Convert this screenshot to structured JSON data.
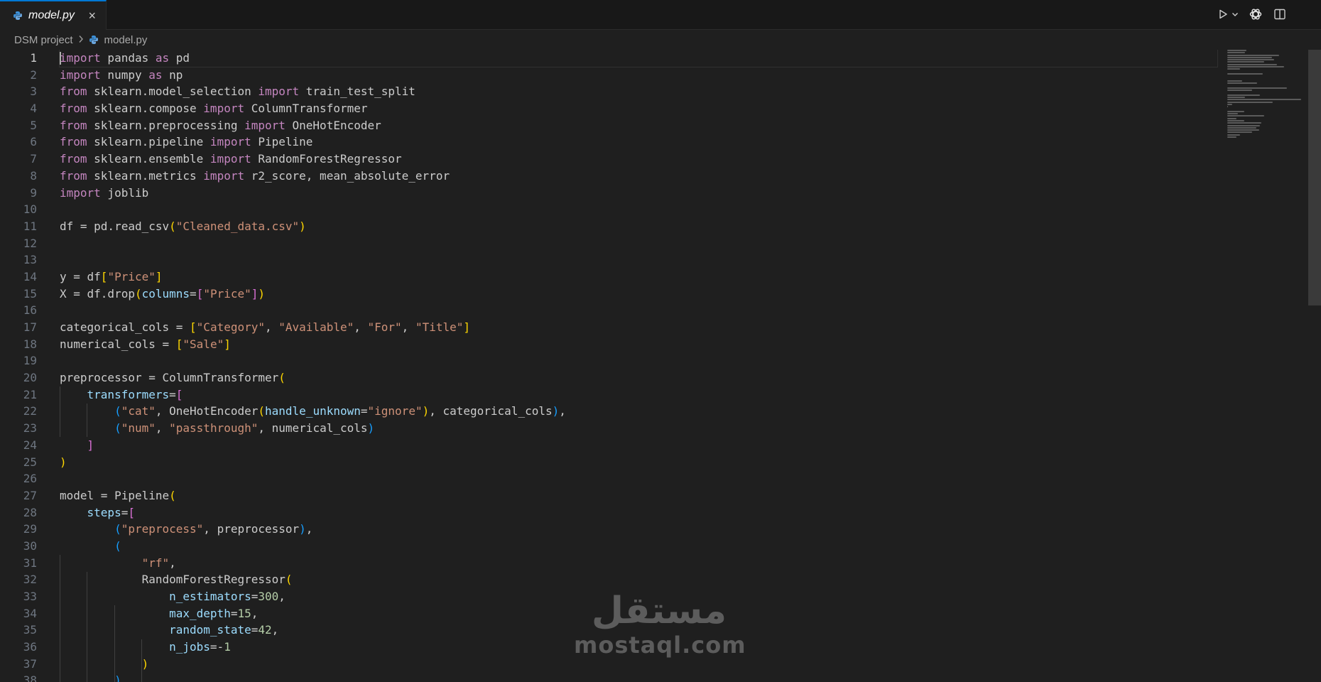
{
  "tab": {
    "filename": "model.py",
    "close_icon": "×"
  },
  "breadcrumb": {
    "project": "DSM project",
    "file": "model.py"
  },
  "editor": {
    "active_line": 1,
    "line_numbers": [
      "1",
      "2",
      "3",
      "4",
      "5",
      "6",
      "7",
      "8",
      "9",
      "10",
      "11",
      "12",
      "13",
      "14",
      "15",
      "16",
      "17",
      "18",
      "19",
      "20",
      "21",
      "22",
      "23",
      "24",
      "25",
      "26",
      "27",
      "28",
      "29",
      "30",
      "31",
      "32",
      "33",
      "34",
      "35",
      "36",
      "37",
      "38"
    ],
    "lines": [
      [
        [
          "kw",
          "import"
        ],
        [
          "t",
          " pandas "
        ],
        [
          "kw",
          "as"
        ],
        [
          "t",
          " pd"
        ]
      ],
      [
        [
          "kw",
          "import"
        ],
        [
          "t",
          " numpy "
        ],
        [
          "kw",
          "as"
        ],
        [
          "t",
          " np"
        ]
      ],
      [
        [
          "kw",
          "from"
        ],
        [
          "t",
          " sklearn.model_selection "
        ],
        [
          "kw",
          "import"
        ],
        [
          "t",
          " train_test_split"
        ]
      ],
      [
        [
          "kw",
          "from"
        ],
        [
          "t",
          " sklearn.compose "
        ],
        [
          "kw",
          "import"
        ],
        [
          "t",
          " ColumnTransformer"
        ]
      ],
      [
        [
          "kw",
          "from"
        ],
        [
          "t",
          " sklearn.preprocessing "
        ],
        [
          "kw",
          "import"
        ],
        [
          "t",
          " OneHotEncoder"
        ]
      ],
      [
        [
          "kw",
          "from"
        ],
        [
          "t",
          " sklearn.pipeline "
        ],
        [
          "kw",
          "import"
        ],
        [
          "t",
          " Pipeline"
        ]
      ],
      [
        [
          "kw",
          "from"
        ],
        [
          "t",
          " sklearn.ensemble "
        ],
        [
          "kw",
          "import"
        ],
        [
          "t",
          " RandomForestRegressor"
        ]
      ],
      [
        [
          "kw",
          "from"
        ],
        [
          "t",
          " sklearn.metrics "
        ],
        [
          "kw",
          "import"
        ],
        [
          "t",
          " r2_score, mean_absolute_error"
        ]
      ],
      [
        [
          "kw",
          "import"
        ],
        [
          "t",
          " joblib"
        ]
      ],
      [],
      [
        [
          "t",
          "df = pd.read_csv"
        ],
        [
          "pY",
          "("
        ],
        [
          "str",
          "\"Cleaned_data.csv\""
        ],
        [
          "pY",
          ")"
        ]
      ],
      [],
      [],
      [
        [
          "t",
          "y = df"
        ],
        [
          "pY",
          "["
        ],
        [
          "str",
          "\"Price\""
        ],
        [
          "pY",
          "]"
        ]
      ],
      [
        [
          "t",
          "X = df.drop"
        ],
        [
          "pY",
          "("
        ],
        [
          "prm",
          "columns"
        ],
        [
          "t",
          "="
        ],
        [
          "pP",
          "["
        ],
        [
          "str",
          "\"Price\""
        ],
        [
          "pP",
          "]"
        ],
        [
          "pY",
          ")"
        ]
      ],
      [],
      [
        [
          "t",
          "categorical_cols = "
        ],
        [
          "pY",
          "["
        ],
        [
          "str",
          "\"Category\""
        ],
        [
          "t",
          ", "
        ],
        [
          "str",
          "\"Available\""
        ],
        [
          "t",
          ", "
        ],
        [
          "str",
          "\"For\""
        ],
        [
          "t",
          ", "
        ],
        [
          "str",
          "\"Title\""
        ],
        [
          "pY",
          "]"
        ]
      ],
      [
        [
          "t",
          "numerical_cols = "
        ],
        [
          "pY",
          "["
        ],
        [
          "str",
          "\"Sale\""
        ],
        [
          "pY",
          "]"
        ]
      ],
      [],
      [
        [
          "t",
          "preprocessor = ColumnTransformer"
        ],
        [
          "pY",
          "("
        ]
      ],
      [
        [
          "t",
          "    "
        ],
        [
          "prm",
          "transformers"
        ],
        [
          "t",
          "="
        ],
        [
          "pP",
          "["
        ]
      ],
      [
        [
          "t",
          "        "
        ],
        [
          "pB",
          "("
        ],
        [
          "str",
          "\"cat\""
        ],
        [
          "t",
          ", OneHotEncoder"
        ],
        [
          "pY",
          "("
        ],
        [
          "prm",
          "handle_unknown"
        ],
        [
          "t",
          "="
        ],
        [
          "str",
          "\"ignore\""
        ],
        [
          "pY",
          ")"
        ],
        [
          "t",
          ", categorical_cols"
        ],
        [
          "pB",
          ")"
        ],
        [
          "t",
          ","
        ]
      ],
      [
        [
          "t",
          "        "
        ],
        [
          "pB",
          "("
        ],
        [
          "str",
          "\"num\""
        ],
        [
          "t",
          ", "
        ],
        [
          "str",
          "\"passthrough\""
        ],
        [
          "t",
          ", numerical_cols"
        ],
        [
          "pB",
          ")"
        ]
      ],
      [
        [
          "t",
          "    "
        ],
        [
          "pP",
          "]"
        ]
      ],
      [
        [
          "pY",
          ")"
        ]
      ],
      [],
      [
        [
          "t",
          "model = Pipeline"
        ],
        [
          "pY",
          "("
        ]
      ],
      [
        [
          "t",
          "    "
        ],
        [
          "prm",
          "steps"
        ],
        [
          "t",
          "="
        ],
        [
          "pP",
          "["
        ]
      ],
      [
        [
          "t",
          "        "
        ],
        [
          "pB",
          "("
        ],
        [
          "str",
          "\"preprocess\""
        ],
        [
          "t",
          ", preprocessor"
        ],
        [
          "pB",
          ")"
        ],
        [
          "t",
          ","
        ]
      ],
      [
        [
          "t",
          "        "
        ],
        [
          "pB",
          "("
        ]
      ],
      [
        [
          "t",
          "            "
        ],
        [
          "str",
          "\"rf\""
        ],
        [
          "t",
          ","
        ]
      ],
      [
        [
          "t",
          "            RandomForestRegressor"
        ],
        [
          "pY",
          "("
        ]
      ],
      [
        [
          "t",
          "                "
        ],
        [
          "prm",
          "n_estimators"
        ],
        [
          "t",
          "="
        ],
        [
          "num",
          "300"
        ],
        [
          "t",
          ","
        ]
      ],
      [
        [
          "t",
          "                "
        ],
        [
          "prm",
          "max_depth"
        ],
        [
          "t",
          "="
        ],
        [
          "num",
          "15"
        ],
        [
          "t",
          ","
        ]
      ],
      [
        [
          "t",
          "                "
        ],
        [
          "prm",
          "random_state"
        ],
        [
          "t",
          "="
        ],
        [
          "num",
          "42"
        ],
        [
          "t",
          ","
        ]
      ],
      [
        [
          "t",
          "                "
        ],
        [
          "prm",
          "n_jobs"
        ],
        [
          "t",
          "=-"
        ],
        [
          "num",
          "1"
        ]
      ],
      [
        [
          "t",
          "            "
        ],
        [
          "pY",
          ")"
        ]
      ],
      [
        [
          "t",
          "        "
        ],
        [
          "pB",
          ")"
        ]
      ]
    ]
  },
  "icons": {
    "file_icon": "python-file-icon",
    "run": "run-icon",
    "run_dropdown": "chevron-down-icon",
    "ai": "chatgpt-icon",
    "split": "split-editor-icon"
  },
  "watermark": {
    "logo": "مستقل",
    "text": "mostaql.com"
  },
  "colors": {
    "keyword": "#c586c0",
    "string": "#ce9178",
    "number": "#b5cea8",
    "parameter": "#9cdcfe",
    "bracket1": "#ffd700",
    "bracket2": "#da70d6",
    "bracket3": "#179fff",
    "accent": "#0078d4"
  }
}
